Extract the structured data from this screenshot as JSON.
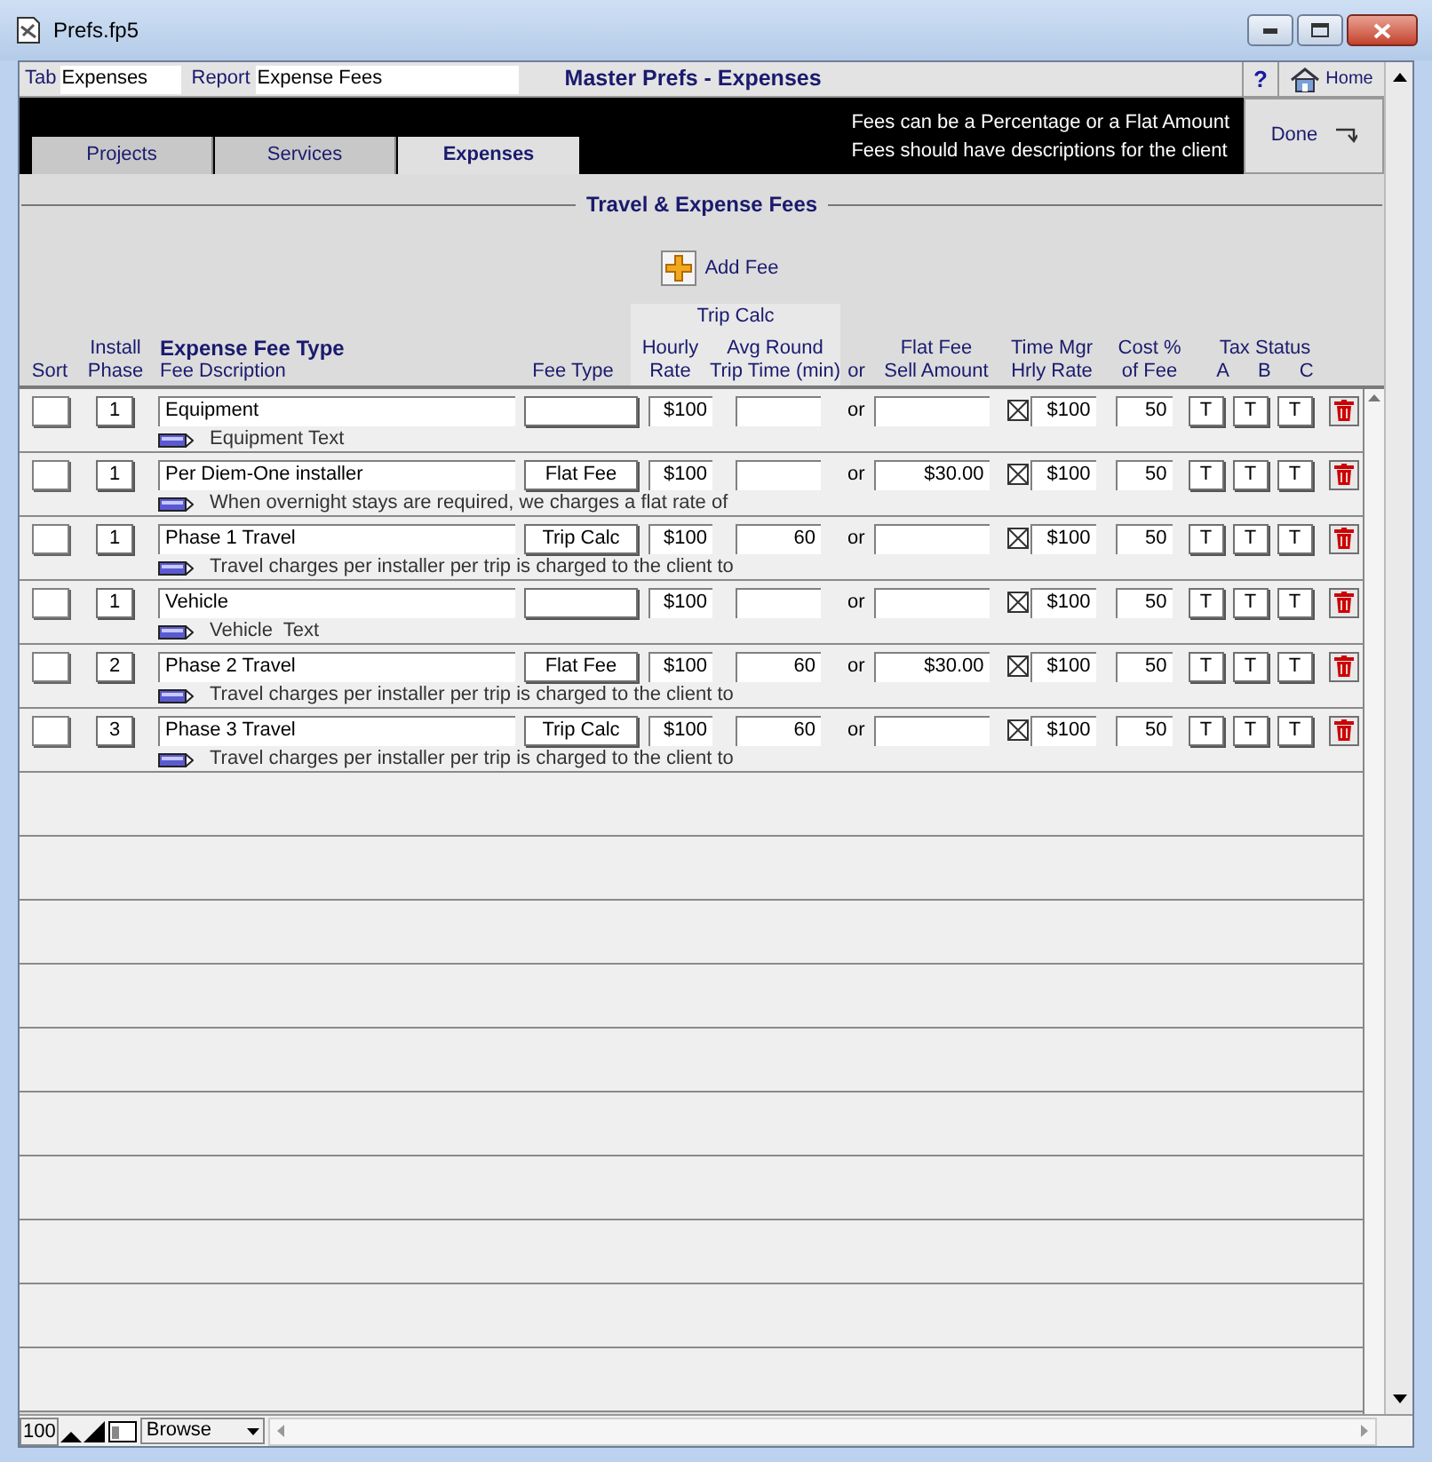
{
  "window": {
    "title": "Prefs.fp5"
  },
  "top_bar": {
    "tab_label": "Tab",
    "tab_value": "Expenses",
    "report_label": "Report",
    "report_value": "Expense Fees",
    "title": "Master Prefs - Expenses",
    "help": "?",
    "home": "Home"
  },
  "tabs": [
    {
      "label": "Projects",
      "selected": false
    },
    {
      "label": "Services",
      "selected": false
    },
    {
      "label": "Expenses",
      "selected": true
    }
  ],
  "notes": [
    "Fees can be a Percentage or a Flat Amount",
    "Fees should have descriptions for the client"
  ],
  "done": "Done",
  "section_title": "Travel & Expense Fees",
  "add_fee": "Add Fee",
  "headers": {
    "sort": "Sort",
    "install": "Install",
    "phase": "Phase",
    "fee_type_title": "Expense Fee Type",
    "fee_desc": "Fee Dscription",
    "fee_type": "Fee Type",
    "trip_calc": "Trip Calc",
    "hourly": "Hourly",
    "rate": "Rate",
    "avg_round": "Avg Round",
    "trip_time": "Trip Time (min)",
    "or": "or",
    "flat_fee": "Flat Fee",
    "sell_amount": "Sell Amount",
    "time_mgr": "Time Mgr",
    "hrly_rate": "Hrly Rate",
    "cost_pct": "Cost %",
    "of_fee": "of Fee",
    "tax_status": "Tax Status",
    "a": "A",
    "b": "B",
    "c": "C"
  },
  "rows": [
    {
      "phase": "1",
      "name": "Equipment",
      "fee_type": "",
      "hourly": "$100",
      "trip_time": "",
      "or": "or",
      "flat_fee": "",
      "checked": true,
      "hrly_rate": "$100",
      "cost": "50",
      "tax": [
        "T",
        "T",
        "T"
      ],
      "note": "Equipment Text"
    },
    {
      "phase": "1",
      "name": "Per Diem-One installer",
      "fee_type": "Flat Fee",
      "hourly": "$100",
      "trip_time": "",
      "or": "or",
      "flat_fee": "$30.00",
      "checked": true,
      "hrly_rate": "$100",
      "cost": "50",
      "tax": [
        "T",
        "T",
        "T"
      ],
      "note": "When overnight stays are required, we charges a flat rate of"
    },
    {
      "phase": "1",
      "name": "Phase 1 Travel",
      "fee_type": "Trip Calc",
      "hourly": "$100",
      "trip_time": "60",
      "or": "or",
      "flat_fee": "",
      "checked": true,
      "hrly_rate": "$100",
      "cost": "50",
      "tax": [
        "T",
        "T",
        "T"
      ],
      "note": "Travel charges per installer per trip is charged to the client to"
    },
    {
      "phase": "1",
      "name": "Vehicle",
      "fee_type": "",
      "hourly": "$100",
      "trip_time": "",
      "or": "or",
      "flat_fee": "",
      "checked": true,
      "hrly_rate": "$100",
      "cost": "50",
      "tax": [
        "T",
        "T",
        "T"
      ],
      "note": "Vehicle  Text"
    },
    {
      "phase": "2",
      "name": "Phase 2 Travel",
      "fee_type": "Flat Fee",
      "hourly": "$100",
      "trip_time": "60",
      "or": "or",
      "flat_fee": "$30.00",
      "checked": true,
      "hrly_rate": "$100",
      "cost": "50",
      "tax": [
        "T",
        "T",
        "T"
      ],
      "note": "Travel charges per installer per trip is charged to the client to"
    },
    {
      "phase": "3",
      "name": "Phase 3 Travel",
      "fee_type": "Trip Calc",
      "hourly": "$100",
      "trip_time": "60",
      "or": "or",
      "flat_fee": "",
      "checked": true,
      "hrly_rate": "$100",
      "cost": "50",
      "tax": [
        "T",
        "T",
        "T"
      ],
      "note": "Travel charges per installer per trip is charged to the client to"
    }
  ],
  "status_bar": {
    "zoom": "100",
    "mode": "Browse"
  }
}
